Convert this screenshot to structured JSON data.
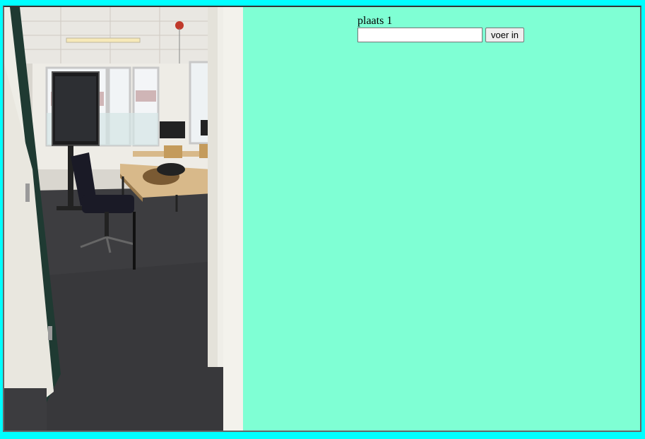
{
  "form": {
    "label": "plaats 1",
    "input_value": "",
    "input_placeholder": "",
    "submit_label": "voer in"
  },
  "colors": {
    "outer_background": "#00ffff",
    "content_background": "#7fffd4"
  }
}
